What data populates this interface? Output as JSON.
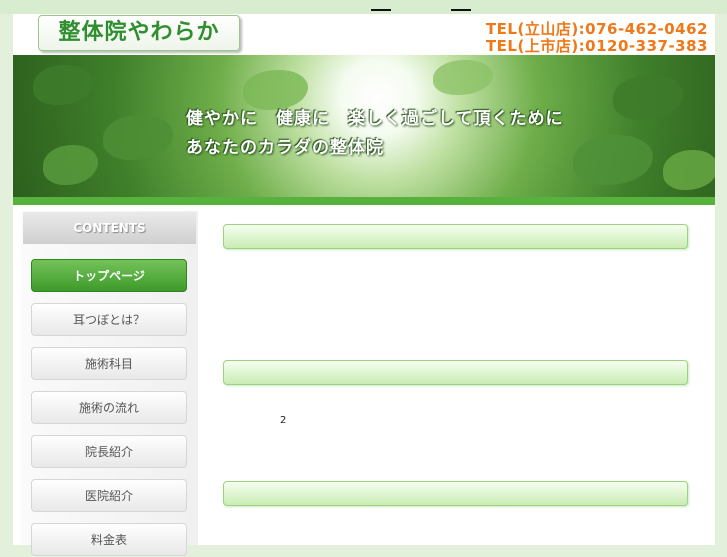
{
  "site": {
    "title": "整体院やわらか",
    "tel_lines": [
      "TEL(立山店):076-462-0462",
      "TEL(上市店):0120-337-383"
    ]
  },
  "hero": {
    "line1": "健やかに　健康に　楽しく過ごして頂くために",
    "line2": "あなたのカラダの整体院"
  },
  "sidebar": {
    "heading": "CONTENTS",
    "items": [
      {
        "label": "トップページ",
        "active": true
      },
      {
        "label": "耳つぼとは？"
      },
      {
        "label": "施術科目"
      },
      {
        "label": "施術の流れ"
      },
      {
        "label": "院長紹介"
      },
      {
        "label": "医院紹介"
      },
      {
        "label": "料金表"
      }
    ]
  },
  "main": {
    "counter_text": "2"
  },
  "colors": {
    "brand_green": "#2f8f2f",
    "tel_orange": "#f07818",
    "accent_green": "#56b23c"
  }
}
